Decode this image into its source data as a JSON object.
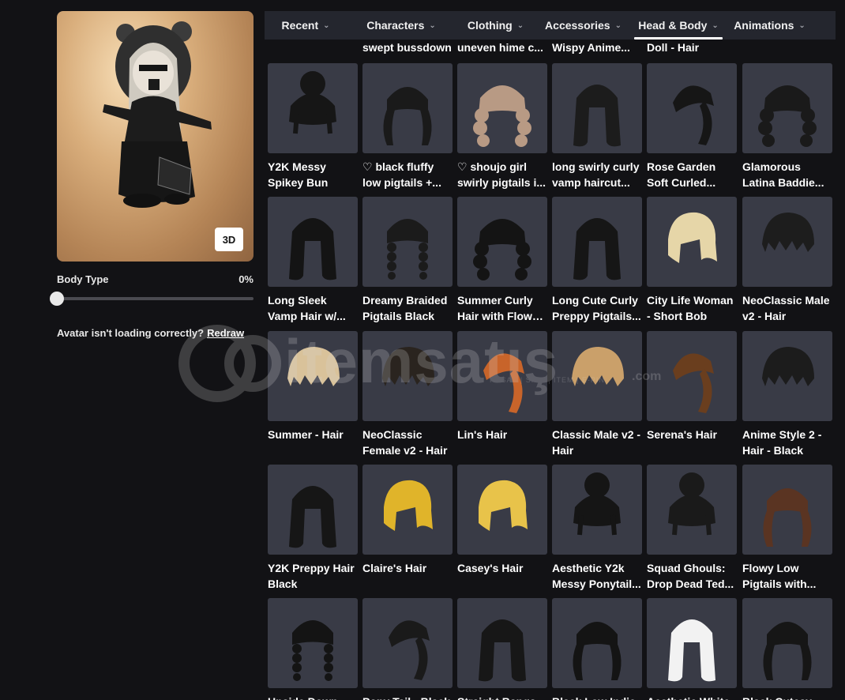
{
  "left_panel": {
    "view_3d_label": "3D",
    "body_type_label": "Body Type",
    "body_type_value": "0%",
    "body_type_level": 0,
    "loading_text": "Avatar isn't loading correctly?",
    "redraw_label": "Redraw"
  },
  "tabs": [
    {
      "label": "Recent",
      "active": false
    },
    {
      "label": "Characters",
      "active": false
    },
    {
      "label": "Clothing",
      "active": false
    },
    {
      "label": "Accessories",
      "active": false
    },
    {
      "label": "Head & Body",
      "active": true
    },
    {
      "label": "Animations",
      "active": false
    }
  ],
  "top_captions": [
    "",
    "swept bussdown",
    "uneven hime c...",
    "Wispy Anime...",
    "Doll - Hair",
    ""
  ],
  "items": [
    {
      "l1": "Y2K Messy",
      "l2": "Spikey Bun",
      "color": "#161616",
      "shape": "bun"
    },
    {
      "l1": "♡ black fluffy",
      "l2": "low pigtails +...",
      "color": "#1a1a1a",
      "shape": "pigtails"
    },
    {
      "l1": "♡ shoujo girl",
      "l2": "swirly pigtails i...",
      "color": "#b89a84",
      "shape": "curly"
    },
    {
      "l1": "long swirly curly",
      "l2": "vamp haircut...",
      "color": "#1c1c1c",
      "shape": "long"
    },
    {
      "l1": "Rose Garden",
      "l2": "Soft Curled...",
      "color": "#161616",
      "shape": "side"
    },
    {
      "l1": "Glamorous",
      "l2": "Latina Baddie...",
      "color": "#1a1a1a",
      "shape": "curly"
    },
    {
      "l1": "Long Sleek",
      "l2": "Vamp Hair w/...",
      "color": "#141414",
      "shape": "long"
    },
    {
      "l1": "Dreamy Braided",
      "l2": "Pigtails Black",
      "color": "#1b1b1b",
      "shape": "braids"
    },
    {
      "l1": "Summer Curly",
      "l2": "Hair with Flowe...",
      "color": "#141414",
      "shape": "curly"
    },
    {
      "l1": "Long Cute Curly",
      "l2": "Preppy Pigtails...",
      "color": "#161616",
      "shape": "long"
    },
    {
      "l1": "City Life Woman",
      "l2": "- Short Bob",
      "color": "#e6d6a8",
      "shape": "bob"
    },
    {
      "l1": "NeoClassic Male",
      "l2": "v2 - Hair",
      "color": "#1d1d1d",
      "shape": "short"
    },
    {
      "l1": "Summer - Hair",
      "l2": "",
      "color": "#d9c29a",
      "shape": "short"
    },
    {
      "l1": "NeoClassic",
      "l2": "Female v2 - Hair",
      "color": "#2a241f",
      "shape": "short"
    },
    {
      "l1": "Lin's Hair",
      "l2": "",
      "color": "#c8642a",
      "shape": "side"
    },
    {
      "l1": "Classic Male v2 -",
      "l2": "Hair",
      "color": "#caa06a",
      "shape": "short"
    },
    {
      "l1": "Serena's Hair",
      "l2": "",
      "color": "#6a3e1e",
      "shape": "side"
    },
    {
      "l1": "Anime Style 2 -",
      "l2": "Hair - Black",
      "color": "#1c1c1c",
      "shape": "short"
    },
    {
      "l1": "Y2K Preppy Hair",
      "l2": "Black",
      "color": "#161616",
      "shape": "long"
    },
    {
      "l1": "Claire's Hair",
      "l2": "",
      "color": "#e0b42a",
      "shape": "bob"
    },
    {
      "l1": "Casey's Hair",
      "l2": "",
      "color": "#e8c34a",
      "shape": "bob"
    },
    {
      "l1": "Aesthetic Y2k",
      "l2": "Messy Ponytail...",
      "color": "#151515",
      "shape": "bun"
    },
    {
      "l1": "Squad Ghouls:",
      "l2": "Drop Dead Ted...",
      "color": "#1a1a1a",
      "shape": "bun"
    },
    {
      "l1": "Flowy Low",
      "l2": "Pigtails with...",
      "color": "#5a3422",
      "shape": "pigtails"
    },
    {
      "l1": "Upside Down",
      "l2": "",
      "color": "#141414",
      "shape": "braids"
    },
    {
      "l1": "Pony Tail - Black",
      "l2": "",
      "color": "#1a1a1a",
      "shape": "side"
    },
    {
      "l1": "Straight Bangs -",
      "l2": "",
      "color": "#171717",
      "shape": "long"
    },
    {
      "l1": "Black Low Indie",
      "l2": "",
      "color": "#141414",
      "shape": "pigtails"
    },
    {
      "l1": "Aesthetic White",
      "l2": "",
      "color": "#f2f2f2",
      "shape": "long"
    },
    {
      "l1": "Black Cutesy",
      "l2": "",
      "color": "#161616",
      "shape": "pigtails"
    }
  ],
  "watermark": {
    "text": "itemsatış",
    "sub": "HESAP | SKIN | ITEM | E-PIN",
    "tld": ".com"
  }
}
